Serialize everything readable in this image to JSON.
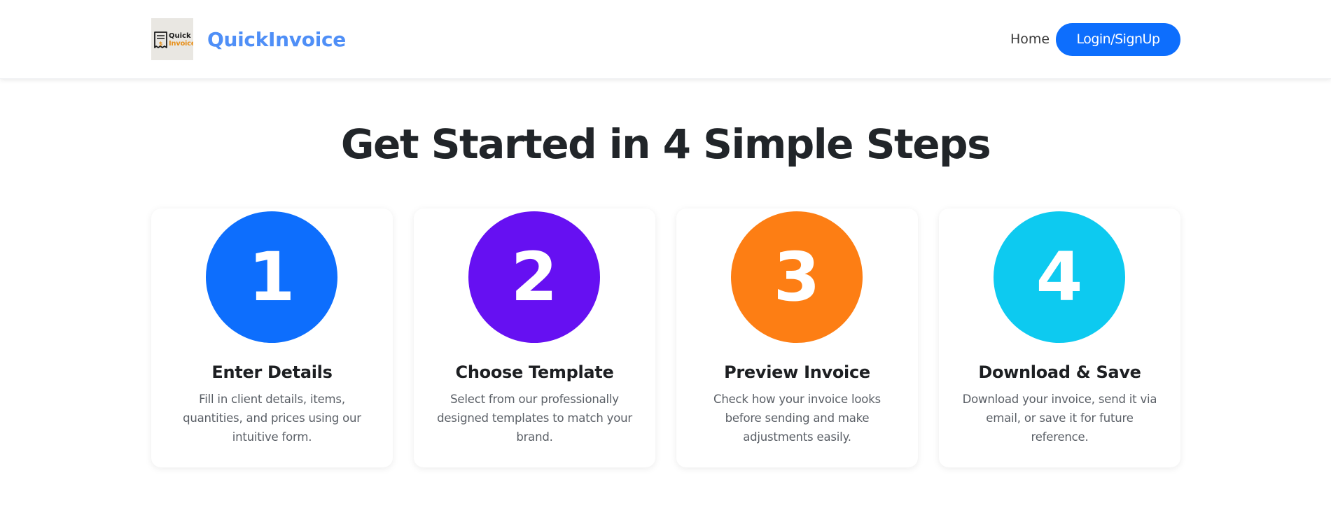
{
  "navbar": {
    "logo": {
      "word1": "Quick",
      "word2": "Invoice",
      "accent_color": "#e8921e"
    },
    "brand_name": "QuickInvoice",
    "brand_color": "#4f8ff7",
    "links": {
      "home": "Home"
    },
    "auth_button_label": "Login/SignUp",
    "auth_button_color": "#0d6efd"
  },
  "steps_section": {
    "title": "Get Started in 4 Simple Steps",
    "steps": [
      {
        "number": "1",
        "color": "#0d6efd",
        "title": "Enter Details",
        "description": "Fill in client details, items, quantities, and prices using our intuitive form."
      },
      {
        "number": "2",
        "color": "#6610f2",
        "title": "Choose Template",
        "description": "Select from our professionally designed templates to match your brand."
      },
      {
        "number": "3",
        "color": "#fd7e14",
        "title": "Preview Invoice",
        "description": "Check how your invoice looks before sending and make adjustments easily."
      },
      {
        "number": "4",
        "color": "#0dcaf0",
        "title": "Download & Save",
        "description": "Download your invoice, send it via email, or save it for future reference."
      }
    ]
  }
}
